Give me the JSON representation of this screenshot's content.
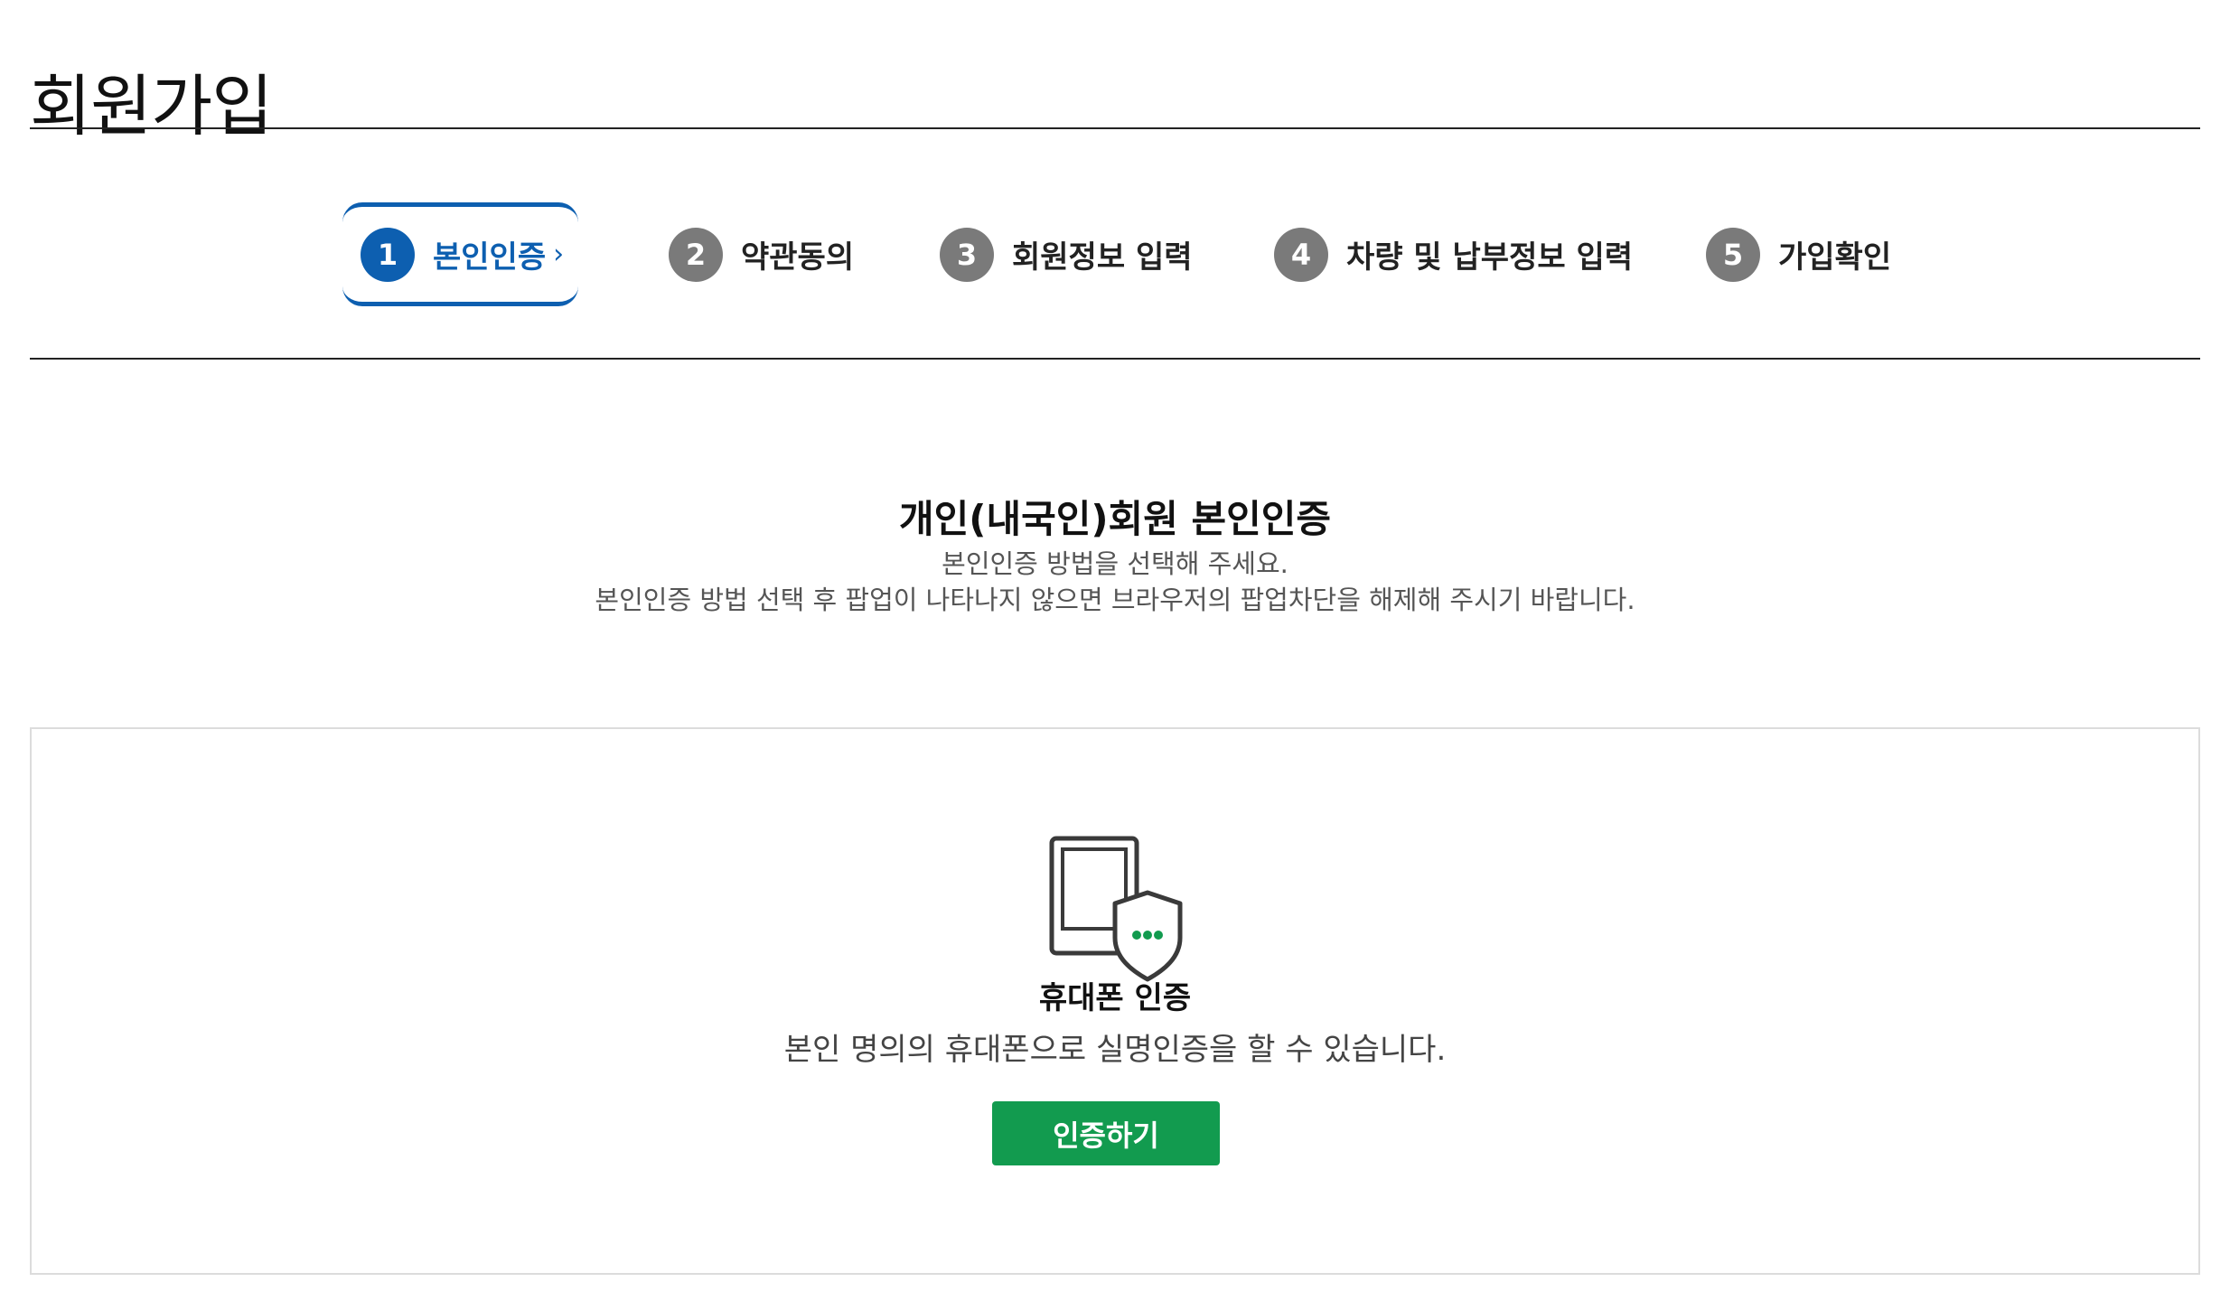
{
  "page": {
    "title": "회원가입"
  },
  "steps": [
    {
      "number": "1",
      "label": "본인인증",
      "active": true,
      "chevron": "›"
    },
    {
      "number": "2",
      "label": "약관동의",
      "active": false
    },
    {
      "number": "3",
      "label": "회원정보 입력",
      "active": false
    },
    {
      "number": "4",
      "label": "차량 및 납부정보 입력",
      "active": false
    },
    {
      "number": "5",
      "label": "가입확인",
      "active": false
    }
  ],
  "section": {
    "heading": "개인(내국인)회원 본인인증",
    "desc_line1": "본인인증 방법을 선택해 주세요.",
    "desc_line2": "본인인증 방법 선택 후 팝업이 나타나지 않으면 브라우저의 팝업차단을 해제해 주시기 바랍니다."
  },
  "phone_auth": {
    "icon": "phone-shield-icon",
    "title": "휴대폰 인증",
    "description": "본인 명의의 휴대폰으로 실명인증을 할 수 있습니다.",
    "button_label": "인증하기"
  },
  "colors": {
    "active_step": "#0d5fb0",
    "inactive_step_circle": "#7a7a7a",
    "button_green": "#129b4f",
    "shield_dots": "#129b4f"
  }
}
